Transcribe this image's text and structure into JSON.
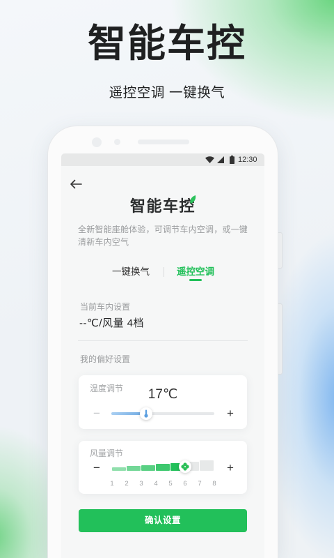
{
  "headline": {
    "title": "智能车控",
    "subtitle": "遥控空调 一键换气"
  },
  "status_bar": {
    "time": "12:30",
    "icons": [
      "wifi-icon",
      "signal-icon",
      "battery-icon"
    ]
  },
  "app": {
    "back_icon": "back-arrow-icon",
    "logo_text": "智能车控",
    "logo_icon": "leaf-icon",
    "description": "全新智能座舱体验，可调节车内空调，或一键清新车内空气",
    "tabs": [
      {
        "label": "一键换气",
        "active": false
      },
      {
        "label": "遥控空调",
        "active": true
      }
    ],
    "current": {
      "label": "当前车内设置",
      "value": "--℃/风量 4档"
    },
    "preferences_label": "我的偏好设置",
    "temperature": {
      "label": "温度调节",
      "value": "17℃",
      "decrease": "−",
      "increase": "+",
      "fill_fraction": 0.34,
      "icon": "thermometer-icon"
    },
    "fan": {
      "label": "风量调节",
      "decrease": "−",
      "increase": "+",
      "levels": [
        "1",
        "2",
        "3",
        "4",
        "5",
        "6",
        "7",
        "8"
      ],
      "selected_level": 6,
      "icon": "fan-icon"
    },
    "confirm_label": "确认设置"
  },
  "colors": {
    "accent": "#22c05a",
    "slider_blue": "#6ea9e2",
    "text_dark": "#1f2021"
  }
}
